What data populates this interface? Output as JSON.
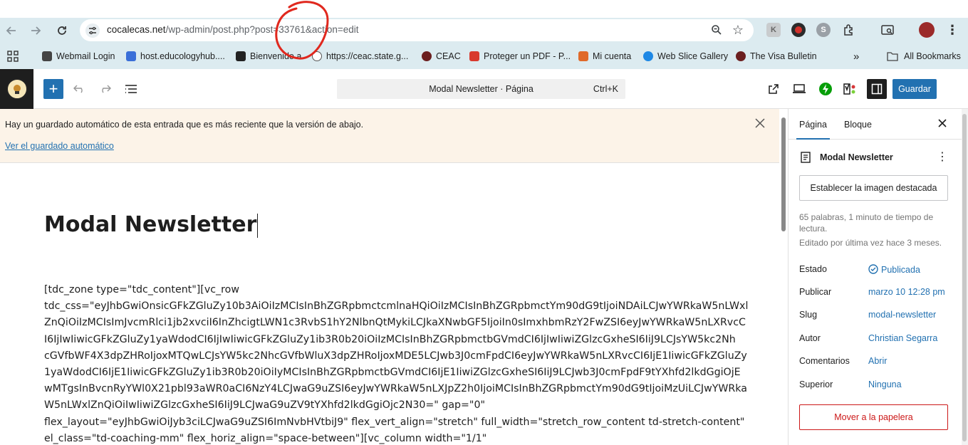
{
  "browser": {
    "url_domain": "cocalecas.net",
    "url_path": "/wp-admin/post.php?post=33761&action=edit",
    "extension_labels": [
      "K",
      "S"
    ]
  },
  "bookmarks": {
    "items": [
      {
        "label": "Webmail Login",
        "color": "#444444"
      },
      {
        "label": "host.educologyhub....",
        "color": "#3a6fd8"
      },
      {
        "label": "Bienvenido a",
        "color": "#222222"
      },
      {
        "label": "https://ceac.state.g...",
        "color": "#555555"
      },
      {
        "label": "CEAC",
        "color": "#6b1f1f"
      },
      {
        "label": "Proteger un PDF - P...",
        "color": "#d83a2e"
      },
      {
        "label": "Mi cuenta",
        "color": "#e06a2a"
      },
      {
        "label": "Web Slice Gallery",
        "color": "#1e88e5"
      },
      {
        "label": "The Visa Bulletin",
        "color": "#6b1f1f"
      }
    ],
    "all_bookmarks_label": "All Bookmarks"
  },
  "toolbar": {
    "document_bar_title": "Modal Newsletter · Página",
    "document_bar_shortcut": "Ctrl+K",
    "save_label": "Guardar"
  },
  "notice": {
    "message": "Hay un guardado automático de esta entrada que es más reciente que la versión de abajo.",
    "link": "Ver el guardado automático"
  },
  "editor": {
    "title": "Modal Newsletter",
    "content_lines": [
      "[tdc_zone type=\"tdc_content\"][vc_row",
      "tdc_css=\"eyJhbGwiOnsicGFkZGluZy10b3AiOiIzMCIsInBhZGRpbmctcmlnaHQiOiIzMCIsInBhZGRpbmctYm90dG9tIjoiNDAiLCJwYWRkaW5nLWxl",
      "ZnQiOiIzMCIsImJvcmRlci1jb2xvciI6InZhcigtLWN1c3RvbS1hY2NlbnQtMykiLCJkaXNwbGF5IjoiIn0sImxhbmRzY2FwZSI6eyJwYWRkaW5nLXRvcC",
      "I6IjIwIiwicGFkZGluZy1yaWdodCI6IjIwIiwicGFkZGluZy1ib3R0b20iOiIzMCIsInBhZGRpbmctbGVmdCI6IjIwIiwiZGlzcGxheSI6IiJ9LCJsYW5kc2Nh",
      "cGVfbWF4X3dpZHRoIjoxMTQwLCJsYW5kc2NhcGVfbWluX3dpZHRoIjoxMDE5LCJwb3J0cmFpdCI6eyJwYWRkaW5nLXRvcCI6IjE1IiwicGFkZGluZy",
      "1yaWdodCI6IjE1IiwicGFkZGluZy1ib3R0b20iOiIyMCIsInBhZGRpbmctbGVmdCI6IjE1IiwiZGlzcGxheSI6IiJ9LCJwb3J0cmFpdF9tYXhfd2lkdGgiOjE",
      "wMTgsInBvcnRyYWl0X21pbl93aWR0aCI6NzY4LCJwaG9uZSI6eyJwYWRkaW5nLXJpZ2h0IjoiMCIsInBhZGRpbmctYm90dG9tIjoiMzUiLCJwYWRka",
      "W5nLWxlZnQiOiIwIiwiZGlzcGxheSI6IiJ9LCJwaG9uZV9tYXhfd2lkdGgiOjc2N30=\" gap=\"0\"",
      "flex_layout=\"eyJhbGwiOiJyb3ciLCJwaG9uZSI6ImNvbHVtbiJ9\" flex_vert_align=\"stretch\" full_width=\"stretch_row_content td-stretch-content\"",
      "el_class=\"td-coaching-mm\" flex_horiz_align=\"space-between\"][vc_column width=\"1/1\""
    ]
  },
  "sidebar": {
    "tab_page": "Página",
    "tab_block": "Bloque",
    "doc_title": "Modal Newsletter",
    "featured_image_button": "Establecer la imagen destacada",
    "word_count_line1": "65 palabras, 1 minuto de tiempo de",
    "word_count_line2": "lectura.",
    "last_edited": "Editado por última vez hace 3 meses.",
    "props": [
      {
        "key": "Estado",
        "value": "Publicada"
      },
      {
        "key": "Publicar",
        "value": "marzo 10 12:28 pm"
      },
      {
        "key": "Slug",
        "value": "modal-newsletter"
      },
      {
        "key": "Autor",
        "value": "Christian Segarra"
      },
      {
        "key": "Comentarios",
        "value": "Abrir"
      },
      {
        "key": "Superior",
        "value": "Ninguna"
      }
    ],
    "trash_button": "Mover a la papelera"
  }
}
